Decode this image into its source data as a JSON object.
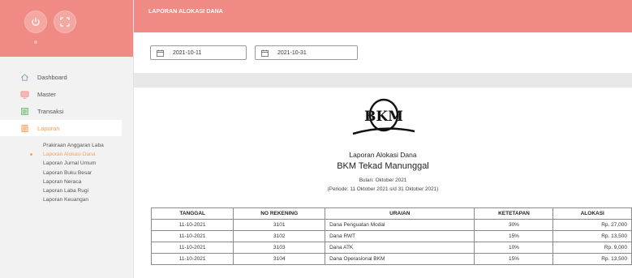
{
  "topbar": {
    "title": "LAPORAN ALOKASI DANA"
  },
  "filter": {
    "start_date": "2021-10-11",
    "end_date": "2021-10-31"
  },
  "sidebar": {
    "items": [
      {
        "label": "Dashboard",
        "icon": "home-icon"
      },
      {
        "label": "Master",
        "icon": "monitor-icon"
      },
      {
        "label": "Transaksi",
        "icon": "transaction-icon"
      },
      {
        "label": "Laporan",
        "icon": "report-icon"
      }
    ],
    "submenu": [
      "Prakiraan Anggaran Laba",
      "Laporan Alokasi Dana",
      "Laporan Jurnal Umum",
      "Laporan Buku Besar",
      "Laporan Neraca",
      "Laporan Laba Rugi",
      "Laporan Keuangan"
    ]
  },
  "report": {
    "logo_text": "BKM",
    "title": "Laporan Alokasi Dana",
    "org": "BKM Tekad Manunggal",
    "month": "Bulan: Oktober 2021",
    "period": "(Periode: 11 Oktober 2021 s/d 31 Oktober 2021)",
    "columns": [
      "TANGGAL",
      "NO REKENING",
      "URAIAN",
      "KETETAPAN",
      "ALOKASI"
    ],
    "rows": [
      {
        "tanggal": "11-10-2021",
        "rekening": "3101",
        "uraian": "Dana Penguatan Modal",
        "ketetapan": "30%",
        "alokasi": "Rp. 27,000"
      },
      {
        "tanggal": "11-10-2021",
        "rekening": "3102",
        "uraian": "Dana RWT",
        "ketetapan": "15%",
        "alokasi": "Rp. 13,500"
      },
      {
        "tanggal": "11-10-2021",
        "rekening": "3103",
        "uraian": "Dana ATK",
        "ketetapan": "10%",
        "alokasi": "Rp. 9,000"
      },
      {
        "tanggal": "11-10-2021",
        "rekening": "3104",
        "uraian": "Dana Operasional BKM",
        "ketetapan": "15%",
        "alokasi": "Rp. 13,500"
      }
    ]
  },
  "colors": {
    "accent": "#f08a84",
    "active": "#f59b5a"
  }
}
